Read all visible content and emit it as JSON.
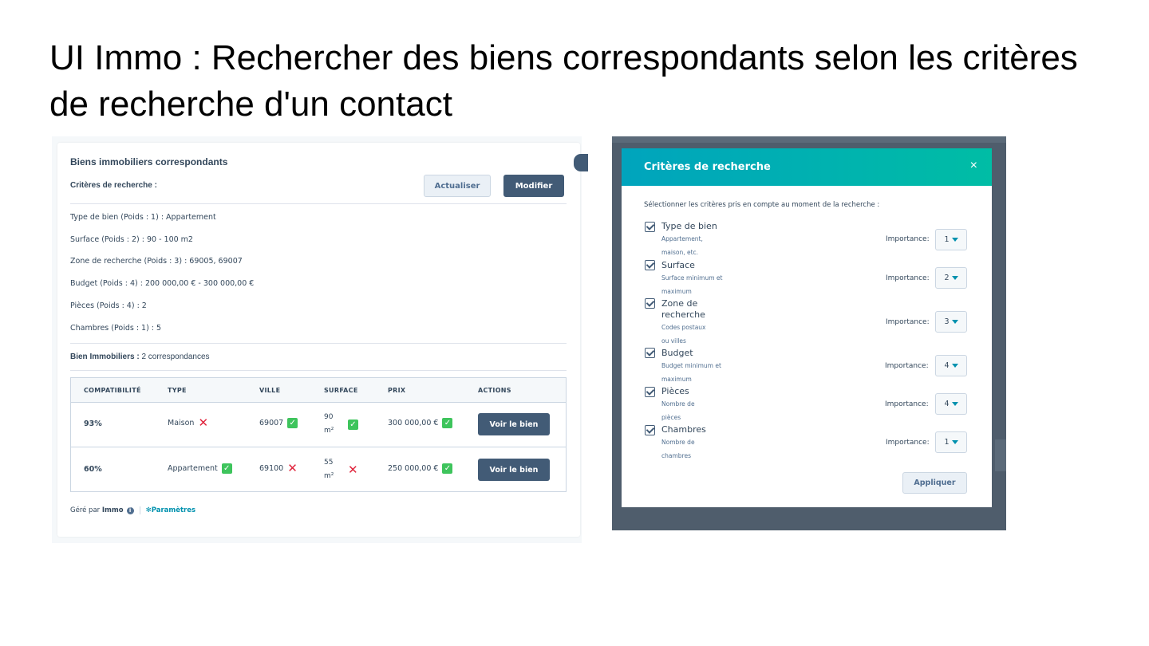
{
  "slide_title": "UI Immo : Rechercher des biens correspondants selon les critères de recherche d'un contact",
  "left": {
    "card_title": "Biens immobiliers correspondants",
    "criteria_label": "Critères de recherche :",
    "refresh_label": "Actualiser",
    "edit_label": "Modifier",
    "criteria": [
      "Type de bien (Poids : 1) : Appartement",
      "Surface (Poids : 2) : 90 - 100 m2",
      "Zone de recherche (Poids : 3) : 69005, 69007",
      "Budget (Poids : 4) : 200 000,00 € - 300 000,00 €",
      "Pièces (Poids : 4) : 2",
      "Chambres (Poids : 1) : 5"
    ],
    "results_label": "Bien Immobiliers :",
    "results_count": "2 correspondances",
    "table": {
      "headers": [
        "COMPATIBILITÉ",
        "TYPE",
        "VILLE",
        "SURFACE",
        "PRIX",
        "ACTIONS"
      ],
      "rows": [
        {
          "compat": "93%",
          "type": "Maison",
          "type_ok": false,
          "ville": "69007",
          "ville_ok": true,
          "surface_num": "90",
          "surface_unit": "m²",
          "surface_ok": true,
          "prix": "300 000,00 €",
          "prix_ok": true,
          "action": "Voir le bien"
        },
        {
          "compat": "60%",
          "type": "Appartement",
          "type_ok": true,
          "ville": "69100",
          "ville_ok": false,
          "surface_num": "55",
          "surface_unit": "m²",
          "surface_ok": false,
          "prix": "250 000,00 €",
          "prix_ok": true,
          "action": "Voir le bien"
        }
      ]
    },
    "footer": {
      "managed_by": "Géré par",
      "brand": "Immo",
      "settings": "Paramètres"
    }
  },
  "modal": {
    "title": "Critères de recherche",
    "close": "×",
    "intro": "Sélectionner les critères pris en compte au moment de la recherche :",
    "importance_label": "Importance:",
    "items": [
      {
        "name": "Type de bien",
        "desc": "Appartement, maison, etc.",
        "importance": "1"
      },
      {
        "name": "Surface",
        "desc": "Surface minimum et maximum",
        "importance": "2"
      },
      {
        "name": "Zone de recherche",
        "desc": "Codes postaux ou villes",
        "importance": "3"
      },
      {
        "name": "Budget",
        "desc": "Budget minimum et maximum",
        "importance": "4"
      },
      {
        "name": "Pièces",
        "desc": "Nombre de pièces",
        "importance": "4"
      },
      {
        "name": "Chambres",
        "desc": "Nombre de chambres",
        "importance": "1"
      }
    ],
    "apply_label": "Appliquer"
  },
  "colors": {
    "accent_teal": "#00a4bd",
    "dark_button": "#425b76",
    "ok_green": "#3ec45c",
    "ko_red": "#e0243c"
  }
}
